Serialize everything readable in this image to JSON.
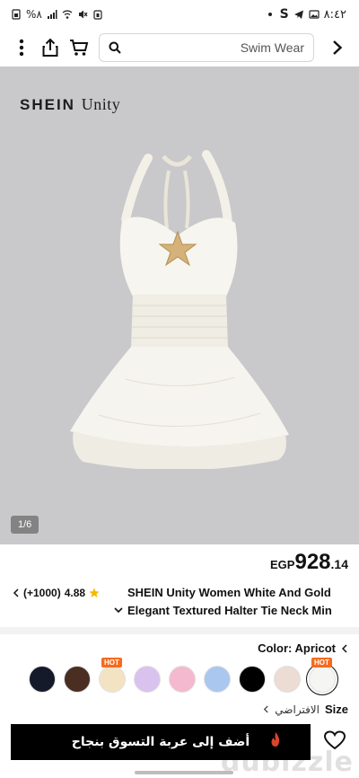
{
  "status_bar": {
    "time": "٨:٤٢",
    "battery": "%٨",
    "left_icons": [
      "sim-icon",
      "battery-icon",
      "signal-icon",
      "wifi-icon",
      "mute-icon",
      "alarm-icon"
    ],
    "right_icons": [
      "s-icon",
      "telegram-icon",
      "gallery-icon",
      "more-dot-icon"
    ],
    "s_letter": "S"
  },
  "top_nav": {
    "search_value": "Swim Wear"
  },
  "image": {
    "brand_main": "SHEIN",
    "brand_sub": "Unity",
    "counter": "1/6"
  },
  "product": {
    "currency": "EGP",
    "price_main": "928",
    "price_dec": ".14",
    "rating": "4.88",
    "review_count": "(+1000)",
    "title_line1": "SHEIN Unity Women White And Gold",
    "title_line2": "Elegant Textured Halter Tie Neck Min"
  },
  "color": {
    "label": "Color: Apricot",
    "swatches": [
      {
        "name": "navy",
        "color": "#151a2b",
        "hot": false
      },
      {
        "name": "brown",
        "color": "#4a2e22",
        "hot": false
      },
      {
        "name": "cream-textured",
        "color": "#f3e3c3",
        "hot": true
      },
      {
        "name": "lilac",
        "color": "#d9c3ee",
        "hot": false
      },
      {
        "name": "pink",
        "color": "#f4b9cf",
        "hot": false
      },
      {
        "name": "light-blue",
        "color": "#a9c7ef",
        "hot": false
      },
      {
        "name": "black",
        "color": "#000000",
        "hot": false
      },
      {
        "name": "beige",
        "color": "#ecdcd3",
        "hot": false
      },
      {
        "name": "white",
        "color": "#f5f5f2",
        "hot": true,
        "selected": true
      }
    ],
    "hot_label": "HOT"
  },
  "size": {
    "label": "Size",
    "default": "الافتراضي"
  },
  "bottom": {
    "add_to_cart": "أضف إلى عربة التسوق بنجاح",
    "watermark": "dubizzle"
  },
  "colors": {
    "image_bg": "#c9c9cb",
    "hot_badge": "#f56b1f",
    "rating_star": "#f5b800"
  }
}
